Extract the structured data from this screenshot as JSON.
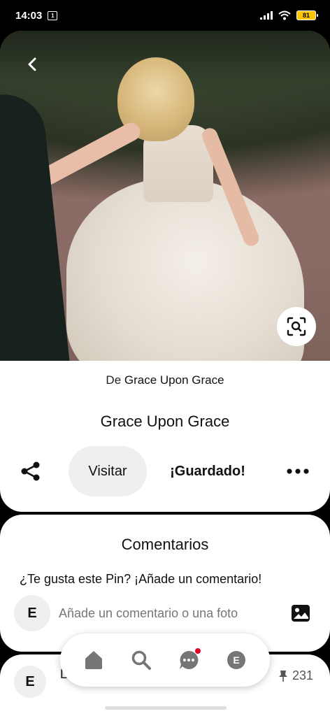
{
  "status_bar": {
    "time": "14:03",
    "calendar_badge": "1",
    "battery_level": "81"
  },
  "pin": {
    "source_prefix": "De",
    "source_name": "Grace Upon Grace",
    "title": "Grace Upon Grace",
    "actions": {
      "visit_label": "Visitar",
      "saved_label": "¡Guardado!"
    }
  },
  "comments": {
    "title": "Comentarios",
    "prompt": "¿Te gusta este Pin? ¡Añade un comentario!",
    "user_initial": "E",
    "input_placeholder": "Añade un comentario o una foto"
  },
  "next_card": {
    "user_initial": "E",
    "text_partial": "L",
    "pin_count": "231"
  },
  "nav": {
    "items": [
      "home-icon",
      "search-icon",
      "messages-icon",
      "profile-avatar"
    ],
    "profile_initial": "E",
    "notification_color": "#e60023"
  }
}
